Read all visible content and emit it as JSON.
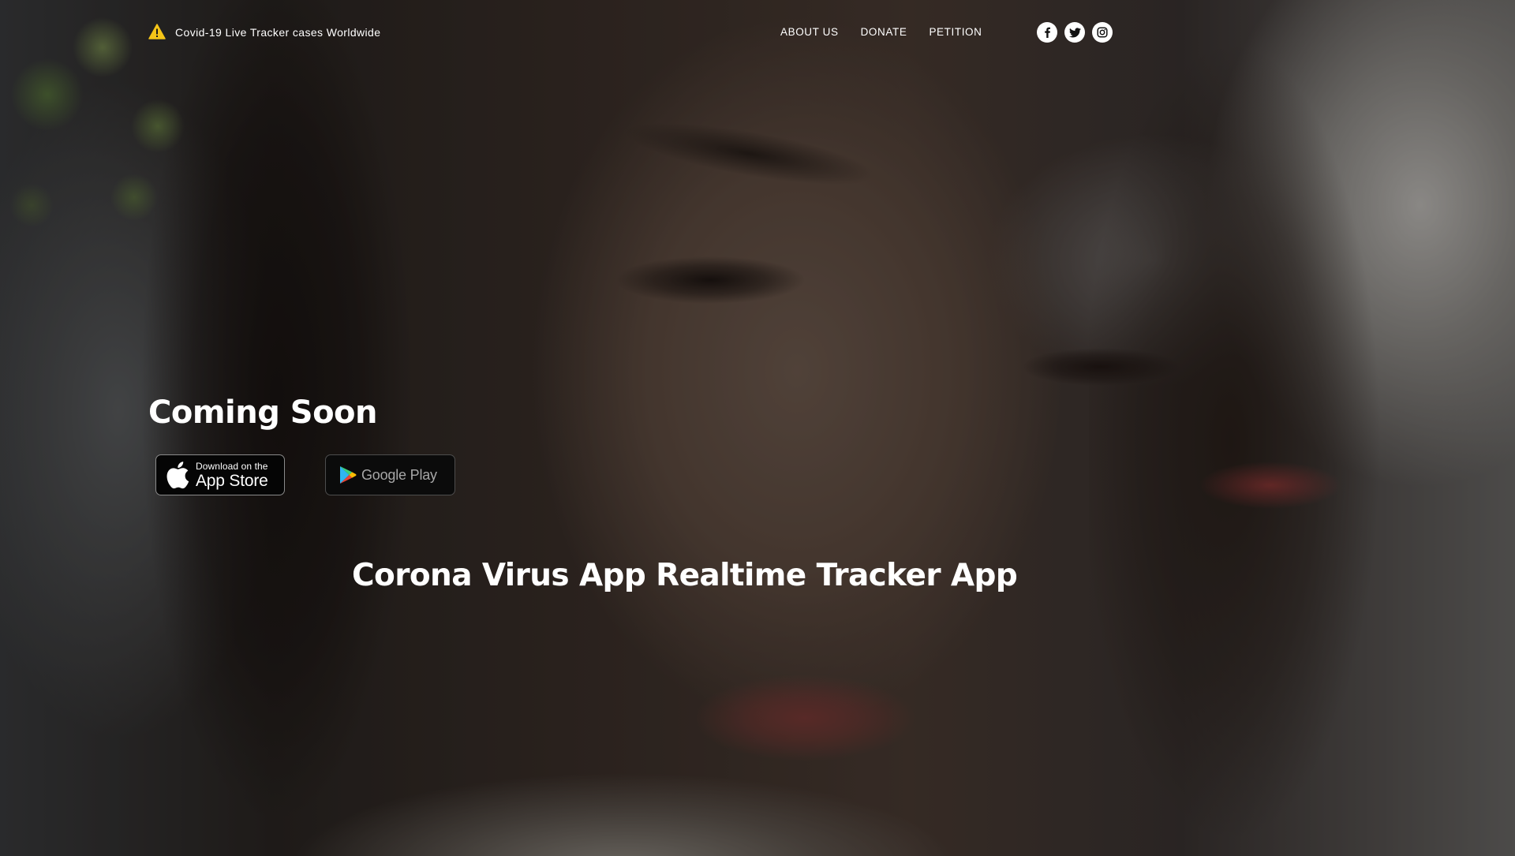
{
  "header": {
    "brand_icon": "warning-icon",
    "brand_icon_color": "#f5c518",
    "brand_text": "Covid-19 Live Tracker cases Worldwide",
    "nav": [
      {
        "label": "ABOUT US"
      },
      {
        "label": "DONATE"
      },
      {
        "label": "PETITION"
      }
    ],
    "social": [
      {
        "icon": "facebook-icon"
      },
      {
        "icon": "twitter-icon"
      },
      {
        "icon": "instagram-icon"
      }
    ]
  },
  "hero": {
    "heading": "Coming Soon",
    "app_store": {
      "icon": "apple-icon",
      "small_text": "Download on the",
      "big_text": "App Store"
    },
    "google_play": {
      "icon": "google-play-icon",
      "text": "Google Play"
    },
    "tagline": "Corona Virus App Realtime Tracker App"
  }
}
